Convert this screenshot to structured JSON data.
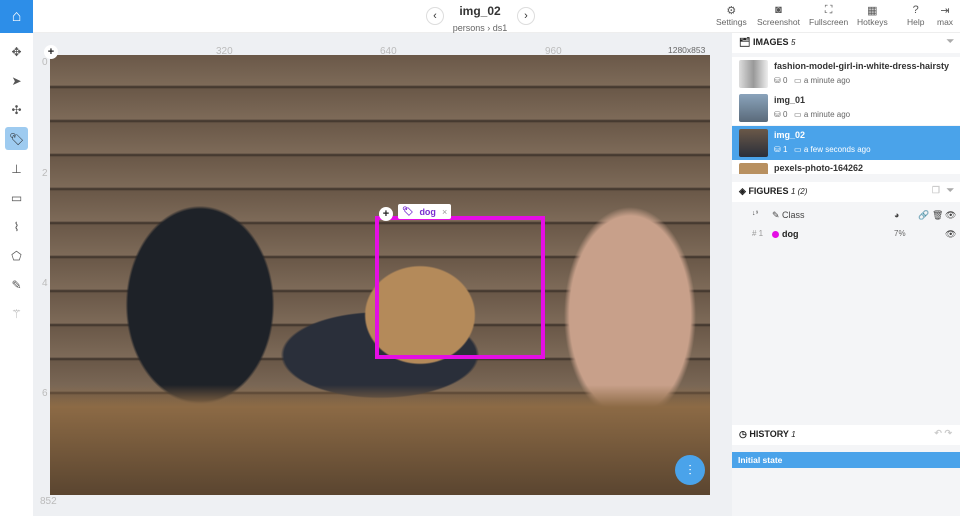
{
  "header": {
    "title": "img_02",
    "breadcrumb": "persons › ds1",
    "prev": "‹",
    "next": "›",
    "tools": [
      {
        "label": "Settings",
        "icon": "⚙"
      },
      {
        "label": "Screenshot",
        "icon": "◙"
      },
      {
        "label": "Fullscreen",
        "icon": "⛶"
      },
      {
        "label": "Hotkeys",
        "icon": "▦"
      },
      {
        "label": "Help",
        "icon": "?"
      },
      {
        "label": "max",
        "icon": "⇥"
      }
    ]
  },
  "toolbar": {
    "icons": [
      "move-icon",
      "pointer-icon",
      "drag-points-icon",
      "tag-icon",
      "point-icon",
      "rectangle-icon",
      "polyline-icon",
      "polygon-icon",
      "brush-icon",
      "magic-wand-icon"
    ]
  },
  "canvas": {
    "ruler_top": [
      "320",
      "640",
      "960"
    ],
    "ruler_left": [
      "0",
      "2",
      "4",
      "6"
    ],
    "size": "1280x853",
    "bottom_label": "852",
    "label": "dog",
    "label_close": "×",
    "colors": {
      "bbox": "#e40ee4"
    }
  },
  "images": {
    "title": "IMAGES",
    "count": "5",
    "items": [
      {
        "name": "fashion-model-girl-in-white-dress-hairsty",
        "figures": "0",
        "time": "a minute ago"
      },
      {
        "name": "img_01",
        "figures": "0",
        "time": "a minute ago"
      },
      {
        "name": "img_02",
        "figures": "1",
        "time": "a few seconds ago",
        "selected": true
      },
      {
        "name": "pexels-photo-164262"
      }
    ]
  },
  "figures": {
    "title": "FIGURES",
    "count": "1 (2)",
    "header": {
      "sort": "↓⁹",
      "class": "Class"
    },
    "items": [
      {
        "index": "# 1",
        "name": "dog",
        "color": "#e40ee4",
        "area": "7%"
      }
    ]
  },
  "history": {
    "title": "HISTORY",
    "count": "1",
    "items": [
      "Initial state"
    ]
  },
  "accent": "#4aa3ea"
}
